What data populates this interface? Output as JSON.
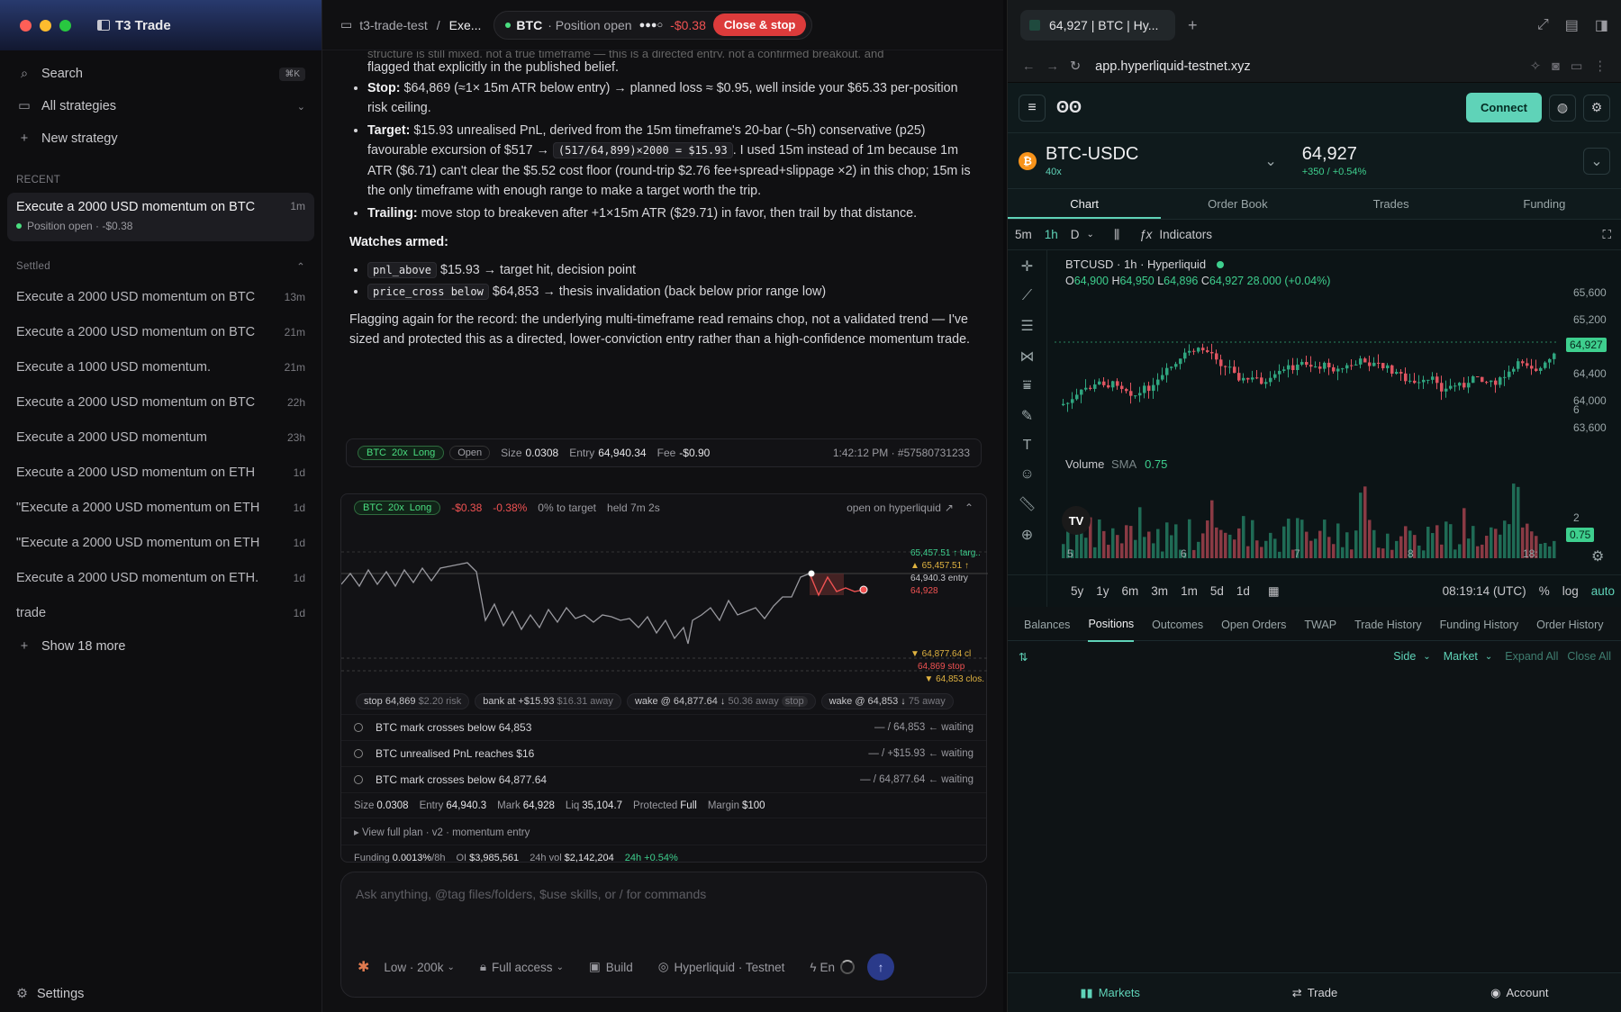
{
  "sidebar": {
    "app_title": "T3 Trade",
    "search": "Search",
    "search_kbd": "⌘K",
    "all_strategies": "All strategies",
    "new_strategy": "New strategy",
    "recent_label": "RECENT",
    "active": {
      "title": "Execute a 2000 USD momentum on BTC",
      "time": "1m",
      "status": "Position open · -$0.38"
    },
    "settled_label": "Settled",
    "settled": [
      {
        "title": "Execute a 2000 USD momentum on BTC",
        "time": "13m"
      },
      {
        "title": "Execute a 2000 USD momentum on BTC",
        "time": "21m"
      },
      {
        "title": "Execute a 1000 USD momentum.",
        "time": "21m"
      },
      {
        "title": "Execute a 2000 USD momentum on BTC",
        "time": "22h"
      },
      {
        "title": "Execute a 2000 USD momentum",
        "time": "23h"
      },
      {
        "title": "Execute a 2000 USD momentum on ETH",
        "time": "1d"
      },
      {
        "title": "\"Execute a 2000 USD momentum on ETH",
        "time": "1d"
      },
      {
        "title": "\"Execute a 2000 USD momentum on ETH",
        "time": "1d"
      },
      {
        "title": "Execute a 2000 USD momentum on ETH.",
        "time": "1d"
      },
      {
        "title": "trade",
        "time": "1d"
      }
    ],
    "show_more": "Show 18 more",
    "settings": "Settings"
  },
  "topbar": {
    "project": "t3-trade-test",
    "sep": "/",
    "thread": "Exe...",
    "symbol": "BTC",
    "status": "· Position open",
    "dots": "●●●○",
    "pnl": "-$0.38",
    "close_btn": "Close & stop"
  },
  "message": {
    "cut_line": "structure is still mixed, not a true timeframe — this is a directed entry, not a confirmed breakout, and",
    "line0": "flagged that explicitly in the published belief.",
    "stop_label": "Stop:",
    "stop_text": "$64,869 (≈1× 15m ATR below entry) → planned loss ≈ $0.95, well inside your $65.33 per-position risk ceiling.",
    "target_label": "Target:",
    "target_text_a": "$15.93 unrealised PnL, derived from the 15m timeframe's 20-bar (~5h) conservative (p25) favourable excursion of $517 →",
    "target_code": "(517/64,899)×2000 = $15.93",
    "target_text_b": ". I used 15m instead of 1m because 1m ATR ($6.71) can't clear the $5.52 cost floor (round-trip $2.76 fee+spread+slippage ×2) in this chop; 15m is the only timeframe with enough range to make a target worth the trip.",
    "trailing_label": "Trailing:",
    "trailing_text": "move stop to breakeven after +1×15m ATR ($29.71) in favor, then trail by that distance.",
    "watches_label": "Watches armed:",
    "w1_code": "pnl_above",
    "w1_text": "$15.93 → target hit, decision point",
    "w2_code": "price_cross below",
    "w2_text": "$64,853 → thesis invalidation (back below prior range low)",
    "closing": "Flagging again for the record: the underlying multi-timeframe read remains chop, not a validated trend — I've sized and protected this as a directed, lower-conviction entry rather than a high-confidence momentum trade."
  },
  "order_card": {
    "sym": "BTC",
    "lev": "20x",
    "side": "Long",
    "state": "Open",
    "size_label": "Size",
    "size": "0.0308",
    "entry_label": "Entry",
    "entry": "64,940.34",
    "fee_label": "Fee",
    "fee": "-$0.90",
    "time": "1:42:12 PM · #57580731233"
  },
  "pos_card": {
    "sym": "BTC",
    "lev": "20x",
    "side": "Long",
    "pnl": "-$0.38",
    "pnl_pct": "-0.38%",
    "to_target": "0% to target",
    "held": "held 7m 2s",
    "open_link": "open on hyperliquid",
    "levels": {
      "target": "65,457.51 ↑ targ..",
      "target2": "▲ 65,457.51 ↑",
      "entry": "64,940.3 entry",
      "mark": "64,928",
      "wake1": "▼ 64,877.64 cl",
      "stop": "64,869 stop",
      "wake2": "▼ 64,853 clos."
    },
    "chips": [
      {
        "a": "stop 64,869",
        "b": "$2.20 risk"
      },
      {
        "a": "bank at +$15.93",
        "b": "$16.31 away"
      },
      {
        "a": "wake @ 64,877.64 ↓",
        "b": "50.36 away",
        "c": "stop"
      },
      {
        "a": "wake @ 64,853 ↓",
        "b": "75 away"
      }
    ],
    "watches": [
      {
        "text": "BTC mark crosses below 64,853",
        "right": "— / 64,853  ← waiting"
      },
      {
        "text": "BTC unrealised PnL reaches $16",
        "right": "— / +$15.93  ← waiting"
      },
      {
        "text": "BTC mark crosses below 64,877.64",
        "right": "— / 64,877.64  ← waiting"
      }
    ],
    "stats": {
      "size_l": "Size",
      "size": "0.0308",
      "entry_l": "Entry",
      "entry": "64,940.3",
      "mark_l": "Mark",
      "mark": "64,928",
      "liq_l": "Liq",
      "liq": "35,104.7",
      "prot_l": "Protected",
      "prot": "Full",
      "margin_l": "Margin",
      "margin": "$100"
    },
    "view_plan": "▸ View full plan · v2 · momentum entry",
    "funding": {
      "f_l": "Funding",
      "f": "0.0013%",
      "f_u": "/8h",
      "oi_l": "OI",
      "oi": "$3,985,561",
      "vol_l": "24h vol",
      "vol": "$2,142,204",
      "chg": "24h +0.54%"
    }
  },
  "input": {
    "placeholder": "Ask anything, @tag files/folders, $use skills, or / for commands",
    "model": "Low · 200k",
    "access": "Full access",
    "build": "Build",
    "venue": "Hyperliquid · Testnet",
    "env": "En"
  },
  "browser": {
    "tab_title": "64,927 | BTC | Hy...",
    "url": "app.hyperliquid-testnet.xyz",
    "connect": "Connect",
    "pair": "BTC-USDC",
    "leverage": "40x",
    "price": "64,927",
    "change": "+350 / +0.54%",
    "tabs": [
      "Chart",
      "Order Book",
      "Trades",
      "Funding"
    ],
    "intervals": [
      "5m",
      "1h",
      "D"
    ],
    "indicators": "Indicators",
    "chart_title": "BTCUSD · 1h · Hyperliquid",
    "ohlc": {
      "o_l": "O",
      "o": "64,900",
      "h_l": "H",
      "h": "64,950",
      "l_l": "L",
      "l": "64,896",
      "c_l": "C",
      "c": "64,927",
      "chg": "28.000 (+0.04%)"
    },
    "volume_label": "Volume",
    "sma": "SMA",
    "sma_val": "0.75",
    "price_axis": [
      "65,600",
      "65,200",
      "64,800",
      "64,400",
      "64,000",
      "63,600"
    ],
    "price_tag": "64,927",
    "vol_axis": [
      "6",
      "2"
    ],
    "vol_tag": "0.75",
    "x_axis": [
      "5",
      "6",
      "7",
      "8",
      "18:"
    ],
    "ranges": [
      "5y",
      "1y",
      "6m",
      "3m",
      "1m",
      "5d",
      "1d"
    ],
    "clock": "08:19:14 (UTC)",
    "pct": "%",
    "log": "log",
    "auto": "auto",
    "bottom_tabs": [
      "Balances",
      "Positions",
      "Outcomes",
      "Open Orders",
      "TWAP",
      "Trade History",
      "Funding History",
      "Order History"
    ],
    "side": "Side",
    "market": "Market",
    "expand_all": "Expand All",
    "close_all": "Close All",
    "footer": [
      "Markets",
      "Trade",
      "Account"
    ]
  },
  "colors": {
    "accent": "#5fd3b8",
    "loss": "#f05252",
    "gain": "#3ecf8e",
    "close_btn": "#dc3b3b"
  }
}
